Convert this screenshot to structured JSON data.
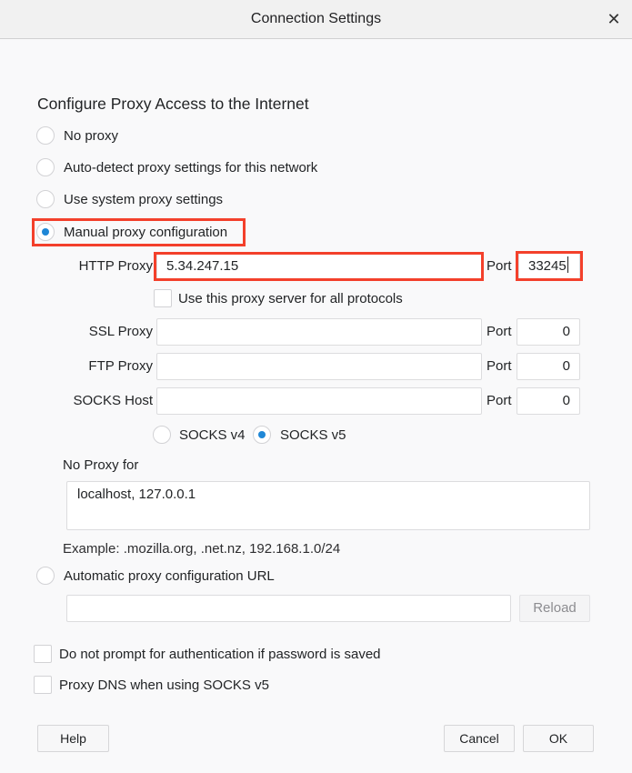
{
  "window": {
    "title": "Connection Settings",
    "close_icon": "close-x-icon"
  },
  "heading": "Configure Proxy Access to the Internet",
  "proxy_modes": [
    {
      "label": "No proxy",
      "selected": false
    },
    {
      "label": "Auto-detect proxy settings for this network",
      "selected": false
    },
    {
      "label": "Use system proxy settings",
      "selected": false
    },
    {
      "label": "Manual proxy configuration",
      "selected": true
    }
  ],
  "manual": {
    "http": {
      "label": "HTTP Proxy",
      "value": "5.34.247.15",
      "port_label": "Port",
      "port": "33245"
    },
    "use_for_all": {
      "label": "Use this proxy server for all protocols",
      "checked": false
    },
    "ssl": {
      "label": "SSL Proxy",
      "value": "",
      "port_label": "Port",
      "port": "0"
    },
    "ftp": {
      "label": "FTP Proxy",
      "value": "",
      "port_label": "Port",
      "port": "0"
    },
    "socks": {
      "label": "SOCKS Host",
      "value": "",
      "port_label": "Port",
      "port": "0"
    },
    "socks_versions": [
      {
        "label": "SOCKS v4",
        "selected": false
      },
      {
        "label": "SOCKS v5",
        "selected": true
      }
    ]
  },
  "no_proxy": {
    "label": "No Proxy for",
    "value": "localhost, 127.0.0.1",
    "example": "Example: .mozilla.org, .net.nz, 192.168.1.0/24"
  },
  "auto_config": {
    "label": "Automatic proxy configuration URL",
    "selected": false,
    "url": "",
    "reload_label": "Reload"
  },
  "options": [
    {
      "label": "Do not prompt for authentication if password is saved",
      "checked": false
    },
    {
      "label": "Proxy DNS when using SOCKS v5",
      "checked": false
    }
  ],
  "buttons": {
    "help": "Help",
    "cancel": "Cancel",
    "ok": "OK"
  },
  "colors": {
    "highlight": "#f3402b",
    "accent": "#1f87d6"
  }
}
